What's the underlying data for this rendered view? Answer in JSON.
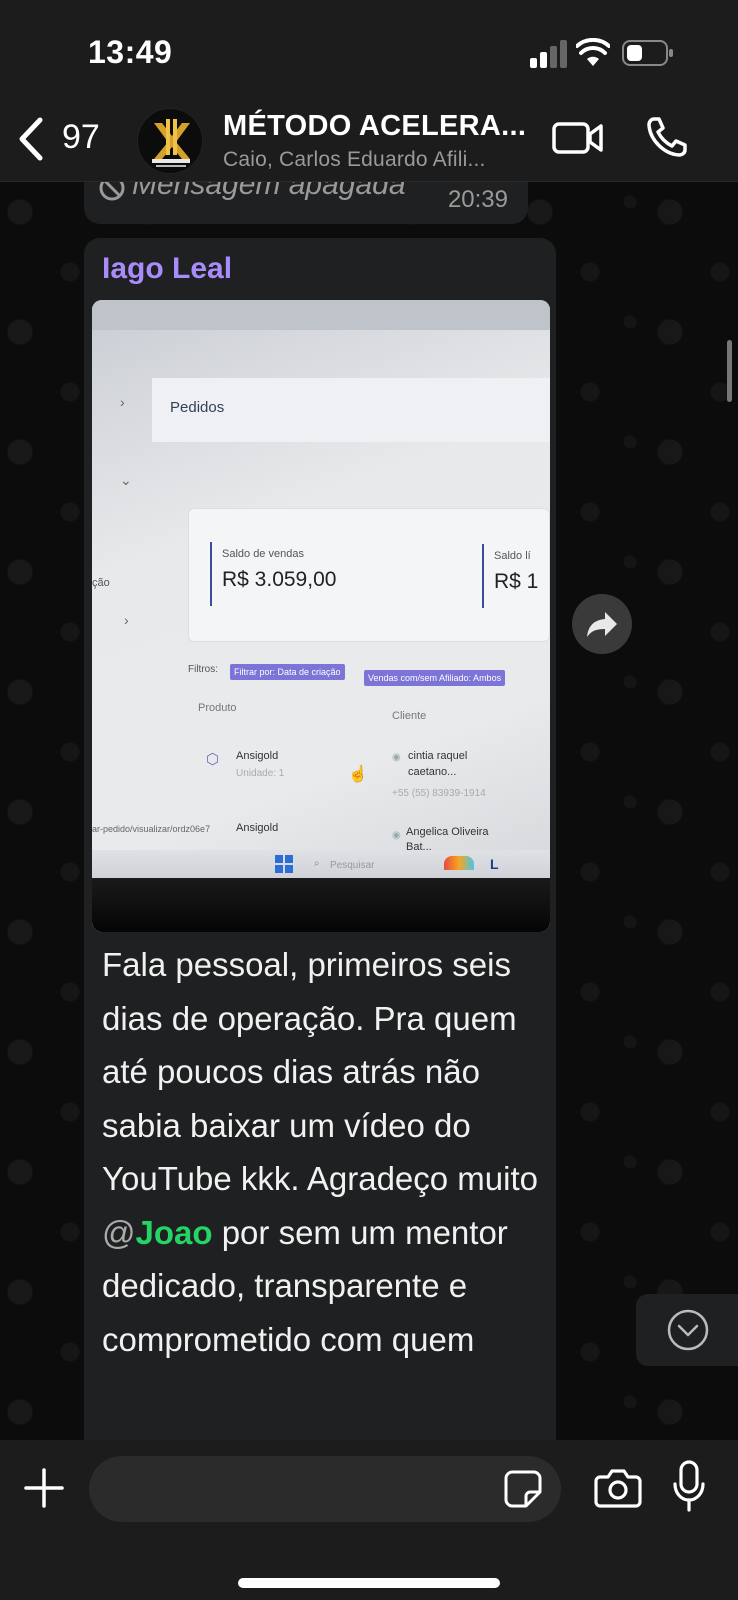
{
  "status_bar": {
    "time": "13:49"
  },
  "header": {
    "back_count": "97",
    "group_title": "MÉTODO ACELERA...",
    "group_members": "Caio, Carlos Eduardo Afili..."
  },
  "messages": {
    "deleted": {
      "text": "Mensagem apagada",
      "time": "20:39"
    },
    "post": {
      "sender": "Iago Leal",
      "text_before_mention": "Fala pessoal, primeiros seis dias de operação. Pra quem até poucos dias atrás não sabia baixar um vídeo do YouTube kkk. Agradeço muito ",
      "mention_at": "@",
      "mention_name": "Joao",
      "text_after_mention": " por sem um mentor dedicado, transparente e comprometido com quem"
    }
  },
  "photo": {
    "page_title": "Pedidos",
    "card1_label": "Saldo de vendas",
    "card1_value": "R$ 3.059,00",
    "card2_label": "Saldo lí",
    "card2_value": "R$ 1",
    "sidebar_fragment": "ção",
    "filters_label": "Filtros:",
    "filter1": "Filtrar por: Data de criação",
    "filter2": "Vendas com/sem Afiliado: Ambos",
    "col_product": "Produto",
    "col_client": "Cliente",
    "row1_product": "Ansigold",
    "row1_unit": "Unidade: 1",
    "row1_client_line1": "cintia raquel",
    "row1_client_line2": "caetano...",
    "row1_phone": "+55 (55) 83939-1914",
    "row2_url": "ar-pedido/visualizar/ordz06e7",
    "row2_product": "Ansigold",
    "row2_client_line1": "Angelica Oliveira",
    "row2_client_line2": "Bat...",
    "taskbar_search": "Pesquisar"
  },
  "input": {
    "placeholder": ""
  },
  "colors": {
    "sender_name": "#a98cfa",
    "mention": "#25d366",
    "bubble": "#1f2021",
    "bar": "#1c1c1d"
  },
  "icons": [
    "back-chevron-icon",
    "video-call-icon",
    "phone-icon",
    "forward-icon",
    "chevron-down-icon",
    "plus-icon",
    "sticker-icon",
    "camera-icon",
    "mic-icon",
    "deleted-icon",
    "signal-icon",
    "wifi-icon",
    "battery-icon"
  ]
}
